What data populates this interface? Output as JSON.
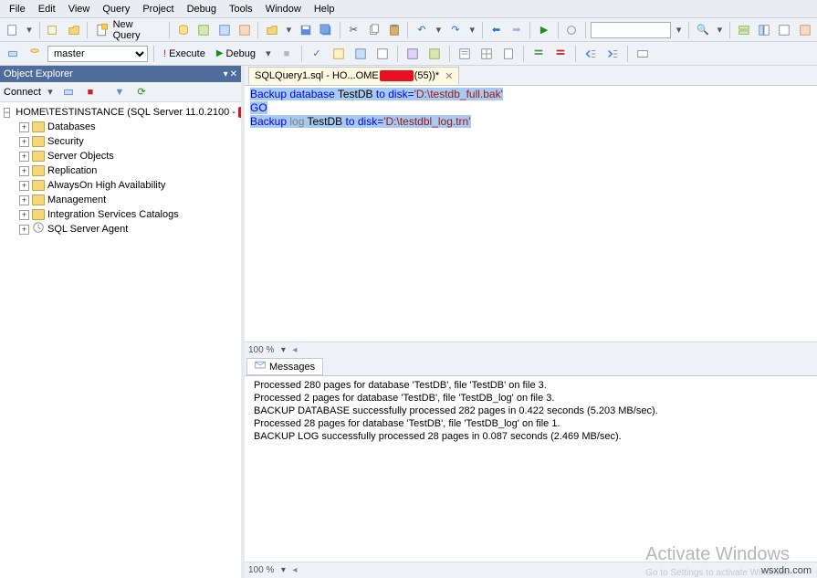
{
  "menu": {
    "items": [
      "File",
      "Edit",
      "View",
      "Query",
      "Project",
      "Debug",
      "Tools",
      "Window",
      "Help"
    ]
  },
  "toolbar1": {
    "new_query": "New Query",
    "icons": [
      "new-icon",
      "open-icon",
      "save-icon",
      "save-all-icon",
      "cut-icon",
      "copy-icon",
      "paste-icon",
      "undo-icon",
      "redo-icon",
      "play-icon",
      "stop-icon"
    ]
  },
  "toolbar2": {
    "db": "master",
    "execute": "Execute",
    "debug": "Debug"
  },
  "explorer": {
    "title": "Object Explorer",
    "connect": "Connect",
    "server": "HOME\\TESTINSTANCE (SQL Server 11.0.2100 - ",
    "server_redacted": "REDACTED",
    "server_suffix": ")",
    "nodes": [
      "Databases",
      "Security",
      "Server Objects",
      "Replication",
      "AlwaysOn High Availability",
      "Management",
      "Integration Services Catalogs",
      "SQL Server Agent"
    ]
  },
  "tab": {
    "label": "SQLQuery1.sql - HO...OME",
    "label_suffix": "(55))*",
    "redact": "xxxxxx"
  },
  "code": {
    "line1_a": "Backup database ",
    "line1_b": "TestDB",
    "line1_c": " to disk=",
    "line1_d": "'D:\\testdb_full.bak'",
    "line2": "GO",
    "line3_a": "Backup ",
    "line3_b": "log ",
    "line3_c": "TestDB",
    "line3_d": " to disk=",
    "line3_e": "'D:\\testdbl_log.trn'"
  },
  "zoom": "100 %",
  "messages_tab": "Messages",
  "messages": [
    "Processed 280 pages for database 'TestDB', file 'TestDB' on file 3.",
    "Processed 2 pages for database 'TestDB', file 'TestDB_log' on file 3.",
    "BACKUP DATABASE successfully processed 282 pages in 0.422 seconds (5.203 MB/sec).",
    "Processed 28 pages for database 'TestDB', file 'TestDB_log' on file 1.",
    "BACKUP LOG successfully processed 28 pages in 0.087 seconds (2.469 MB/sec)."
  ],
  "zoom2": "100 %",
  "watermark": "Activate Windows",
  "watermark_sub": "Go to Settings to activate Windows.",
  "source": "wsxdn.com"
}
